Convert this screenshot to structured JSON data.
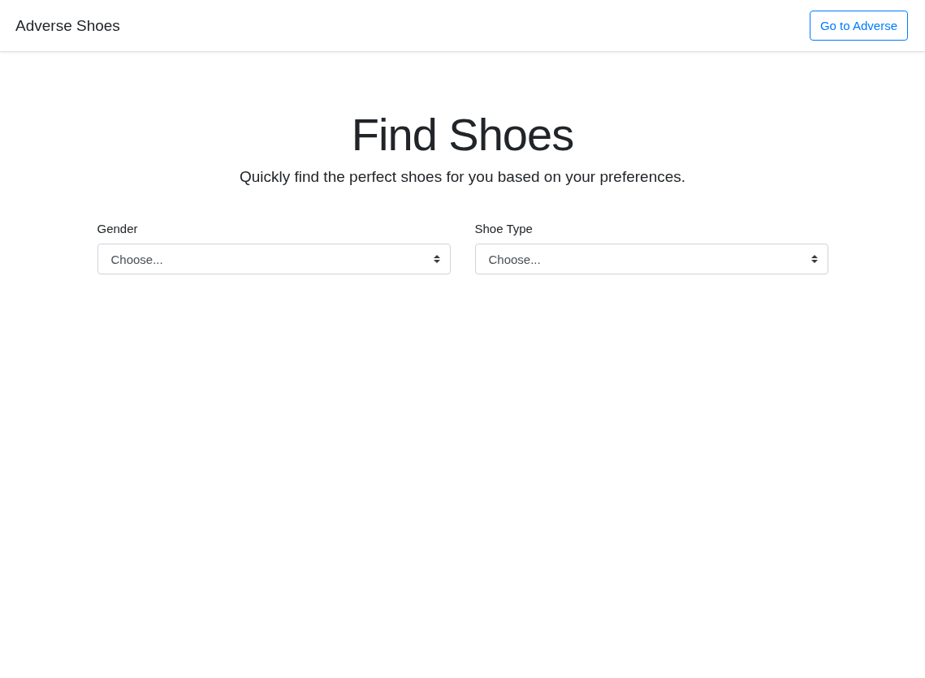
{
  "navbar": {
    "brand": "Adverse Shoes",
    "button": "Go to Adverse"
  },
  "hero": {
    "title": "Find Shoes",
    "subtitle": "Quickly find the perfect shoes for you based on your preferences."
  },
  "filters": [
    {
      "label": "Gender",
      "value": "Choose..."
    },
    {
      "label": "Shoe Type",
      "value": "Choose..."
    }
  ]
}
